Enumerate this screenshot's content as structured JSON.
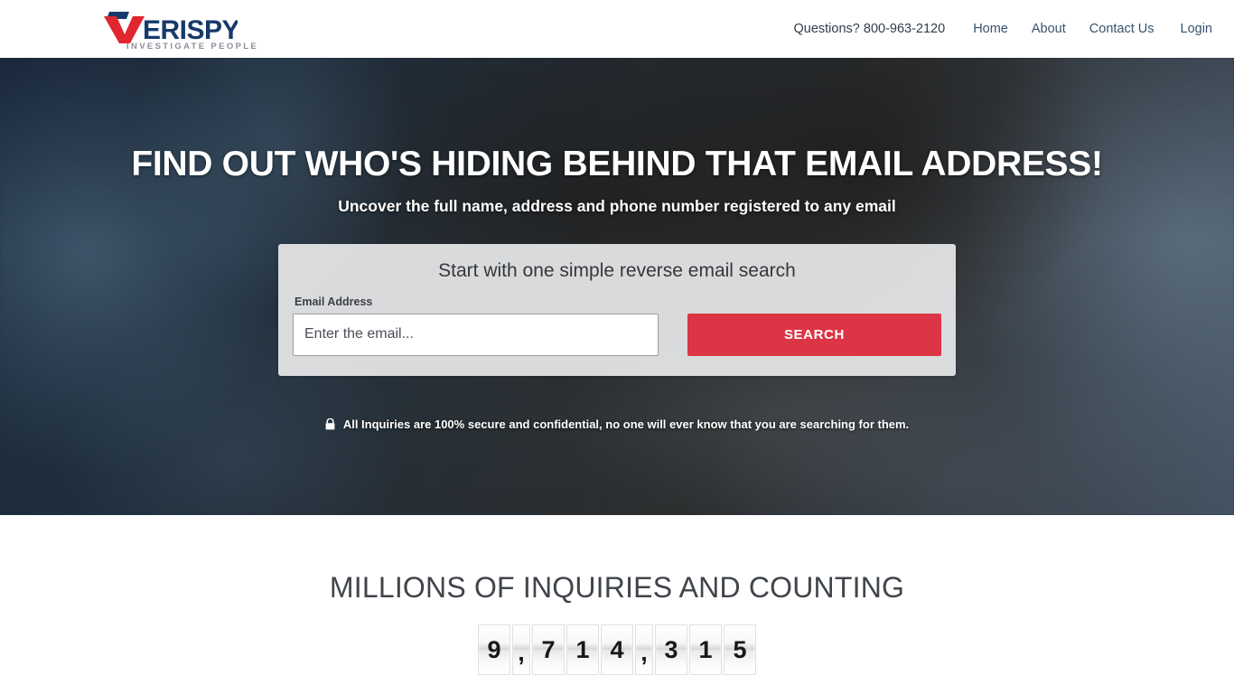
{
  "header": {
    "logo": {
      "name_primary": "V",
      "name_rest": "ERISPY",
      "tagline": "INVESTIGATE PEOPLE",
      "color_red": "#E0262F",
      "color_blue": "#173A6B"
    },
    "phone_text": "Questions? 800-963-2120",
    "nav": [
      {
        "label": "Home"
      },
      {
        "label": "About"
      },
      {
        "label": "Contact Us"
      },
      {
        "label": "Login"
      }
    ]
  },
  "hero": {
    "title": "FIND OUT WHO'S HIDING BEHIND THAT EMAIL ADDRESS!",
    "subtitle": "Uncover the full name, address and phone number registered to any email",
    "card": {
      "title": "Start with one simple reverse email search",
      "field_label": "Email Address",
      "input_value": "",
      "input_placeholder": "Enter the email...",
      "button_label": "SEARCH",
      "button_color": "#DC3545"
    },
    "secure_note": "All Inquiries are 100% secure and confidential, no one will ever know that you are searching for them.",
    "secure_icon": "lock-icon"
  },
  "counter": {
    "title": "MILLIONS OF INQUIRIES AND COUNTING",
    "value": "9,714,315",
    "cells": [
      "9",
      ",",
      "7",
      "1",
      "4",
      ",",
      "3",
      "1",
      "5"
    ]
  }
}
